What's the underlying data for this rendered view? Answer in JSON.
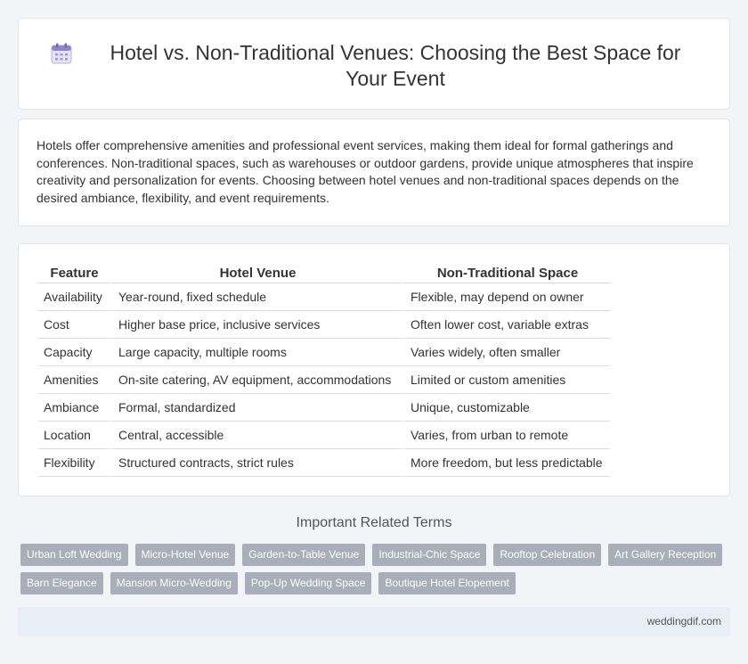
{
  "header": {
    "title": "Hotel vs. Non-Traditional Venues: Choosing the Best Space for Your Event",
    "icon": "calendar-icon"
  },
  "intro": {
    "text": "Hotels offer comprehensive amenities and professional event services, making them ideal for formal gatherings and conferences. Non-traditional spaces, such as warehouses or outdoor gardens, provide unique atmospheres that inspire creativity and personalization for events. Choosing between hotel venues and non-traditional spaces depends on the desired ambiance, flexibility, and event requirements."
  },
  "comparison": {
    "headers": [
      "Feature",
      "Hotel Venue",
      "Non-Traditional Space"
    ],
    "rows": [
      [
        "Availability",
        "Year-round, fixed schedule",
        "Flexible, may depend on owner"
      ],
      [
        "Cost",
        "Higher base price, inclusive services",
        "Often lower cost, variable extras"
      ],
      [
        "Capacity",
        "Large capacity, multiple rooms",
        "Varies widely, often smaller"
      ],
      [
        "Amenities",
        "On-site catering, AV equipment, accommodations",
        "Limited or custom amenities"
      ],
      [
        "Ambiance",
        "Formal, standardized",
        "Unique, customizable"
      ],
      [
        "Location",
        "Central, accessible",
        "Varies, from urban to remote"
      ],
      [
        "Flexibility",
        "Structured contracts, strict rules",
        "More freedom, but less predictable"
      ]
    ]
  },
  "related": {
    "title": "Important Related Terms",
    "tags": [
      "Urban Loft Wedding",
      "Micro-Hotel Venue",
      "Garden-to-Table Venue",
      "Industrial-Chic Space",
      "Rooftop Celebration",
      "Art Gallery Reception",
      "Barn Elegance",
      "Mansion Micro-Wedding",
      "Pop-Up Wedding Space",
      "Boutique Hotel Elopement"
    ]
  },
  "footer": {
    "site": "weddingdif.com"
  },
  "colors": {
    "tag_bg": "#a9aeb8",
    "footer_bg": "#e9edf6",
    "page_bg": "#f3f4f8"
  }
}
